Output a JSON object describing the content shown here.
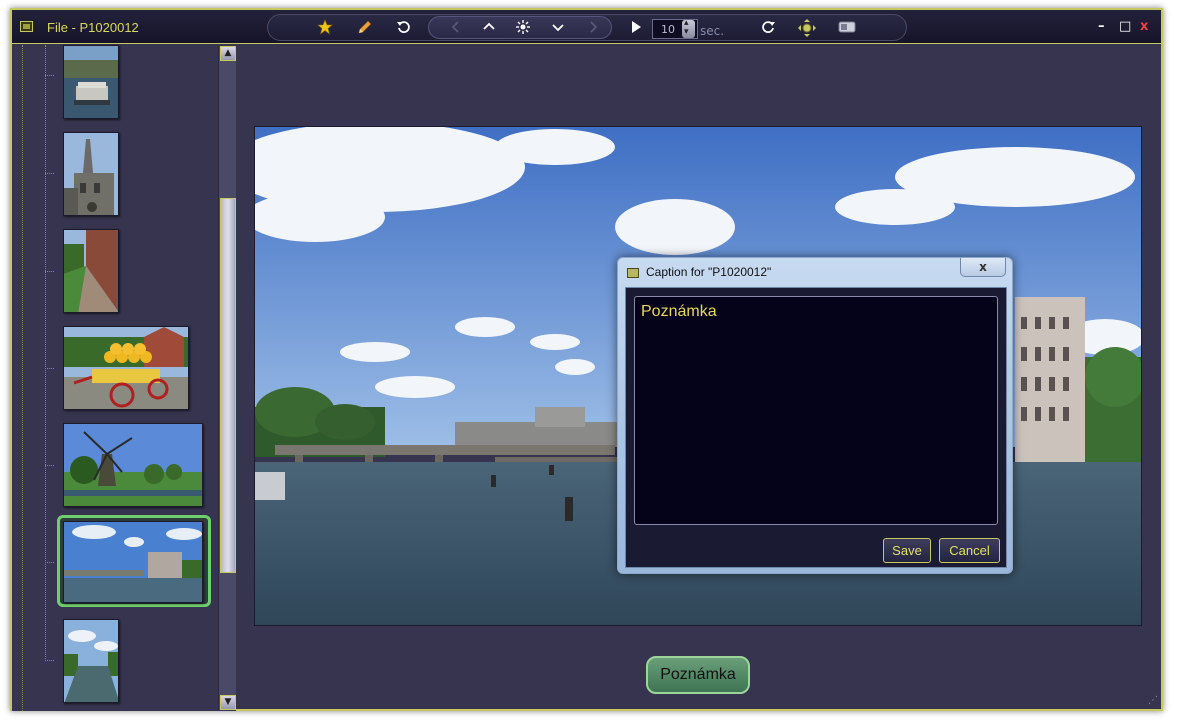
{
  "window": {
    "title": "File - P1020012"
  },
  "toolbar": {
    "interval_value": "10",
    "interval_unit": "sec.",
    "icons": [
      "star-icon",
      "pencil-icon",
      "rotate-icon",
      "chevron-left-icon",
      "chevron-up-icon",
      "sun-icon",
      "chevron-down-icon",
      "chevron-right-icon",
      "play-icon",
      "refresh-icon",
      "fullscreen-icon",
      "panel-icon"
    ]
  },
  "window_controls": {
    "minimize": "–",
    "maximize": "□",
    "close": "x"
  },
  "sidebar": {
    "selected_index": 5,
    "thumbnails": [
      {
        "subject": "boat on canal",
        "orientation": "portrait"
      },
      {
        "subject": "church tower",
        "orientation": "portrait"
      },
      {
        "subject": "brick wall path",
        "orientation": "portrait"
      },
      {
        "subject": "cheese cart",
        "orientation": "landscape"
      },
      {
        "subject": "windmill",
        "orientation": "landscape"
      },
      {
        "subject": "amstel river",
        "orientation": "landscape"
      },
      {
        "subject": "canal view",
        "orientation": "portrait"
      }
    ]
  },
  "caption_badge": {
    "text": "Poznámka"
  },
  "dialog": {
    "title": "Caption for \"P1020012\"",
    "close_label": "x",
    "caption_text": "Poznámka",
    "save_label": "Save",
    "cancel_label": "Cancel"
  },
  "colors": {
    "window_bg": "#36344f",
    "accent_yellow": "#c8c860",
    "selection_green": "#6fcf6f",
    "caption_text": "#e8d862"
  }
}
